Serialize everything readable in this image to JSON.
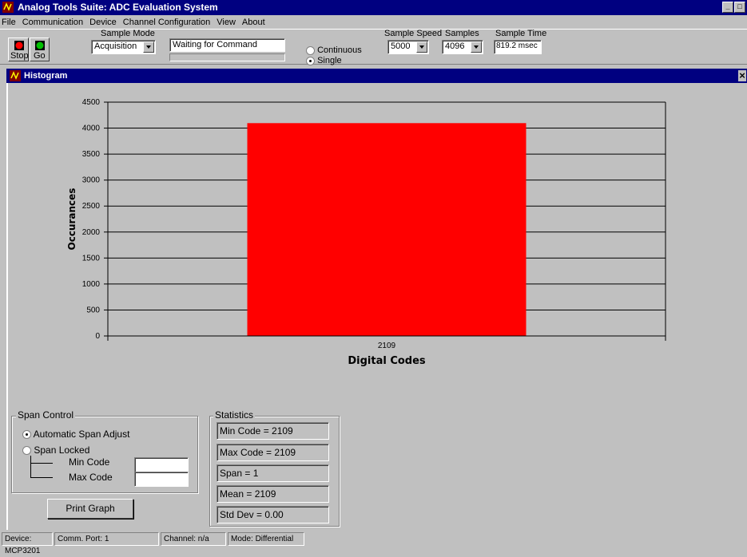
{
  "window": {
    "title": "Analog Tools Suite: ADC Evaluation System",
    "buttons": [
      "_",
      "□"
    ]
  },
  "menu": [
    "File",
    "Communication",
    "Device",
    "Channel Configuration",
    "View",
    "About"
  ],
  "toolbar": {
    "stop_label": "Stop",
    "go_label": "Go",
    "sample_mode_label": "Sample Mode",
    "sample_mode_value": "Acquisition",
    "status_text": "Waiting for Command",
    "continuous_label": "Continuous",
    "single_label": "Single",
    "sample_speed_label": "Sample Speed",
    "sample_speed_value": "5000",
    "samples_label": "Samples",
    "samples_value": "4096",
    "sample_time_label": "Sample Time",
    "sample_time_value": "819.2 msec"
  },
  "histogram_window": {
    "title": "Histogram",
    "close": "×"
  },
  "chart_data": {
    "type": "bar",
    "categories": [
      "2109"
    ],
    "values": [
      4096
    ],
    "xlabel": "Digital Codes",
    "ylabel": "Occurances",
    "ylim": [
      0,
      4500
    ],
    "yticks": [
      "0",
      "500",
      "1000",
      "1500",
      "2000",
      "2500",
      "3000",
      "3500",
      "4000",
      "4500"
    ],
    "grid": true,
    "bar_color": "#ff0000"
  },
  "span_control": {
    "title": "Span Control",
    "auto_label": "Automatic Span Adjust",
    "locked_label": "Span Locked",
    "min_code_label": "Min Code",
    "max_code_label": "Max Code",
    "min_code_value": "",
    "max_code_value": ""
  },
  "print_label": "Print Graph",
  "statistics": {
    "title": "Statistics",
    "min": "Min Code = 2109",
    "max": "Max Code = 2109",
    "span": "Span = 1",
    "mean": "Mean = 2109",
    "std": "Std Dev = 0.00"
  },
  "statusbar": {
    "device": "Device: MCP3201",
    "port": "Comm. Port: 1",
    "channel": "Channel: n/a",
    "mode": "Mode: Differential"
  }
}
